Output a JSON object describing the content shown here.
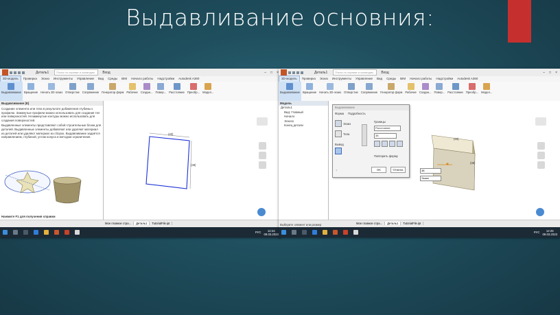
{
  "slide": {
    "title": "Выдавливание основния:"
  },
  "app": {
    "doc_title": "Деталь1",
    "help_search": "Поиск по справке и командам",
    "signin": "Вход",
    "tabs": [
      "3D-модель",
      "Проверка",
      "Эскиз",
      "Инструменты",
      "Управление",
      "Вид",
      "Среды",
      "BIM",
      "Начало работы",
      "Надстройки",
      "Autodesk A360"
    ],
    "ribbon": [
      "Выдавливание",
      "Вращение",
      "Начать 2D-эскиз",
      "Отверстие",
      "Сопряжение",
      "Генератор форм",
      "Рабочие",
      "Создан...",
      "Повер...",
      "Расстояние",
      "Преобр...",
      "Модел..."
    ],
    "doc_tabs": [
      "Мое главное стра...",
      "Деталь1",
      "TutorialFile.ipt"
    ]
  },
  "left_shot": {
    "help": {
      "heading": "Выдавливание (E)",
      "para1": "Создание элемента или тела в результате добавления глубины к профилю. Замкнутые профили можно использовать для создания тел или поверхностей. Незамкнутые контуры можно использовать для создания поверхностей.",
      "para2": "Выдавленные элементы представляют собой строительные блоки для деталей. Выдавленные элементы добавляют или удаляют материал из деталей или удаляют материал из сборок. Выдавливание задаётся направлением, глубиной, углом конуса и методом ограничения.",
      "footer": "Нажмите F1 для получения справки"
    },
    "dims": {
      "top": "(40)",
      "right": "(38)"
    },
    "clock": {
      "time": "12:24",
      "date": "09.03.2023"
    },
    "lang": "РУС"
  },
  "right_shot": {
    "browser": {
      "title": "Модель",
      "items": [
        "Деталь1",
        "Вид: Главный",
        "Начало",
        "Эскиз1",
        "Конец детали"
      ]
    },
    "dialog": {
      "title": "Выдавливание",
      "tabs": [
        "Форма",
        "Подробность"
      ],
      "profile": "Эскиз",
      "solids": "Тела",
      "output": "Вывод",
      "extents_label": "Границы",
      "extents_value": "Расстояние",
      "distance": "38",
      "match_shape": "Повторить форму",
      "ok": "OK",
      "cancel": "Отмена"
    },
    "mini_distance": "38",
    "mini_sketch": "Эскиз",
    "status": "Выберите элемент или размер",
    "dims": {
      "top": "(40)",
      "right": "(38)"
    },
    "clock": {
      "time": "12:25",
      "date": "09.03.2023"
    },
    "lang": "РУС"
  },
  "colors": {
    "accent": "#c5302f",
    "sketch": "#1a2fd6",
    "solid": "#d9d3bd"
  }
}
